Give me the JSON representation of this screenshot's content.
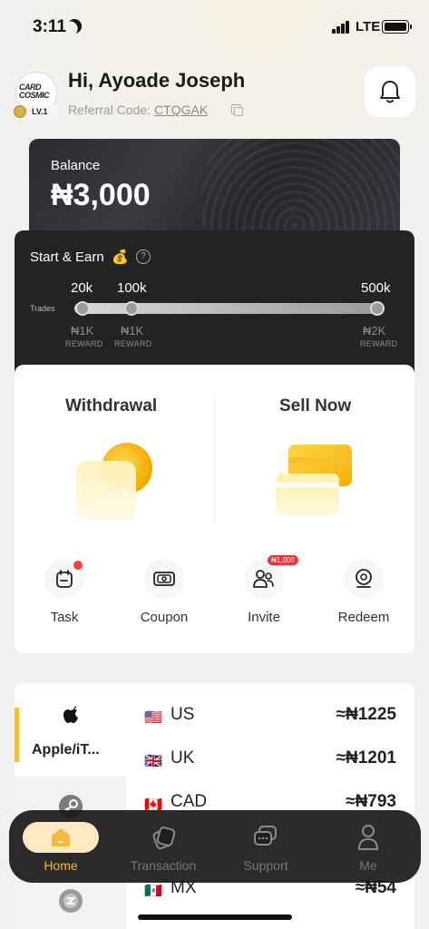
{
  "status_bar": {
    "time": "3:11",
    "network": "LTE"
  },
  "header": {
    "greeting": "Hi, Ayoade Joseph",
    "referral_label": "Referral Code:",
    "referral_code": "CTQGAK",
    "avatar_text": "CARD COSMIC",
    "level": "LV.1"
  },
  "balance": {
    "label": "Balance",
    "value": "₦3,000"
  },
  "start_earn": {
    "title": "Start & Earn",
    "trades_label": "Trades",
    "milestones": [
      {
        "trades": "20k",
        "reward": "₦1K",
        "reward_label": "REWARD"
      },
      {
        "trades": "100k",
        "reward": "₦1K",
        "reward_label": "REWARD"
      },
      {
        "trades": "500k",
        "reward": "₦2K",
        "reward_label": "REWARD"
      }
    ]
  },
  "actions": {
    "withdrawal_label": "Withdrawal",
    "sell_label": "Sell Now"
  },
  "quick_links": [
    {
      "label": "Task",
      "icon": "task-icon"
    },
    {
      "label": "Coupon",
      "icon": "coupon-icon"
    },
    {
      "label": "Invite",
      "icon": "invite-icon",
      "badge": "₦1,000"
    },
    {
      "label": "Redeem",
      "icon": "redeem-icon"
    }
  ],
  "categories": [
    {
      "label": "Apple/iT...",
      "icon": "apple-icon",
      "active": true
    },
    {
      "label": "",
      "icon": "steam-icon",
      "active": false
    },
    {
      "label": "",
      "icon": "gift-card-icon",
      "active": false
    }
  ],
  "rates": [
    {
      "flag": "🇺🇸",
      "country": "US",
      "value": "≈₦1225"
    },
    {
      "flag": "🇬🇧",
      "country": "UK",
      "value": "≈₦1201"
    },
    {
      "flag": "🇨🇦",
      "country": "CAD",
      "value": "≈₦793"
    },
    {
      "flag": "🇲🇽",
      "country": "MX",
      "value": "≈₦54"
    }
  ],
  "nav": [
    {
      "label": "Home",
      "icon": "home-icon",
      "active": true
    },
    {
      "label": "Transaction",
      "icon": "transaction-icon",
      "active": false
    },
    {
      "label": "Support",
      "icon": "support-icon",
      "active": false
    },
    {
      "label": "Me",
      "icon": "profile-icon",
      "active": false
    }
  ],
  "colors": {
    "accent": "#f5b93c",
    "dark": "#232323",
    "badge_red": "#e8353a"
  }
}
